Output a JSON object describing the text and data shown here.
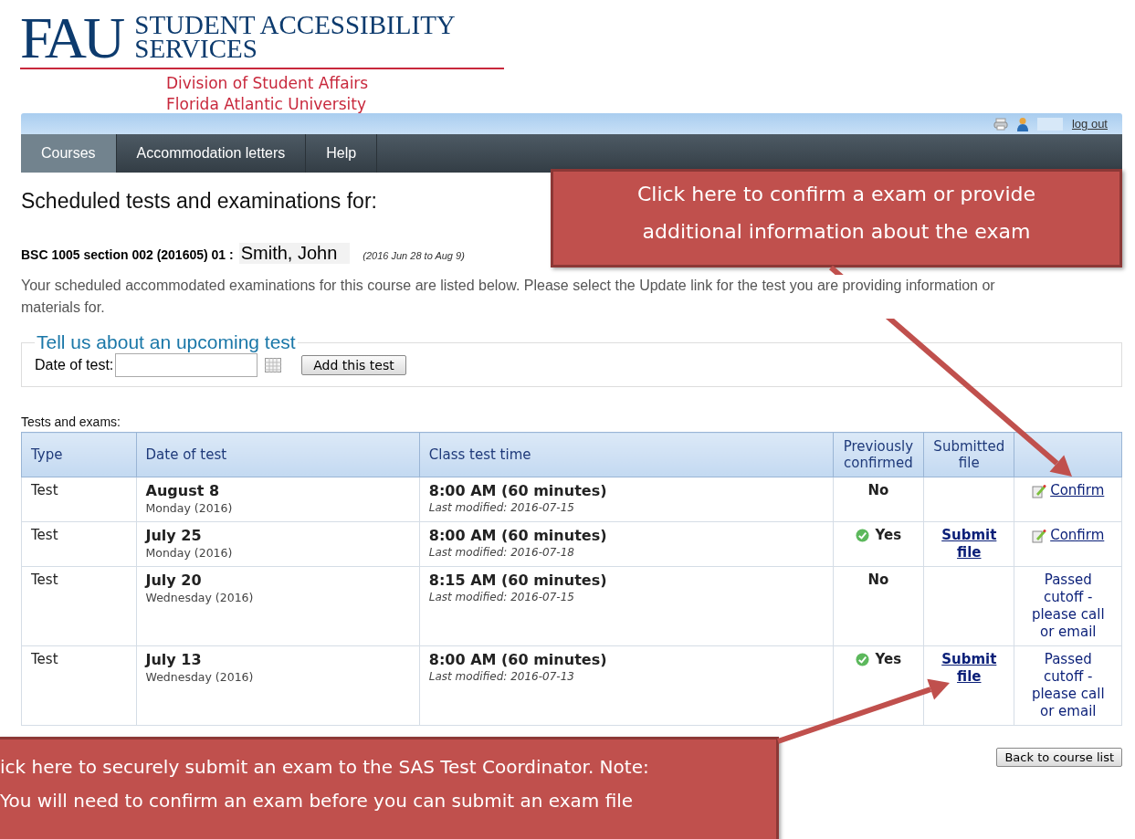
{
  "header": {
    "logo": "FAU",
    "title_lines": [
      "STUDENT ACCESSIBILITY",
      "SERVICES"
    ],
    "subtitle_lines": [
      "Division of Student Affairs",
      "Florida Atlantic University"
    ]
  },
  "toolbar": {
    "logout": "log out"
  },
  "tabs": [
    {
      "label": "Courses",
      "selected": true
    },
    {
      "label": "Accommodation letters",
      "selected": false
    },
    {
      "label": "Help",
      "selected": false
    }
  ],
  "heading": "Scheduled tests and examinations for:",
  "course": {
    "code": "BSC 1005 section 002 (201605) 01 :",
    "student": "Smith, John",
    "dates": "(2016 Jun 28 to Aug 9)"
  },
  "intro": "Your scheduled accommodated examinations for this course are listed below. Please select the Update link for the test you are providing information or materials for.",
  "new_test": {
    "legend": "Tell us about an upcoming test",
    "label": "Date of test:",
    "button": "Add this test"
  },
  "table": {
    "caption": "Tests and exams:",
    "columns": [
      "Type",
      "Date of test",
      "Class test time",
      "Previously confirmed",
      "Submitted file"
    ],
    "rows": [
      {
        "type": "Test",
        "date": "August 8",
        "weekday": "Monday (2016)",
        "time": "8:00 AM (60 minutes)",
        "modified": "Last modified: 2016-07-15",
        "confirmed": false,
        "confirmed_text": "No",
        "file_link": null,
        "action": {
          "kind": "link",
          "text": "Confirm"
        }
      },
      {
        "type": "Test",
        "date": "July 25",
        "weekday": "Monday (2016)",
        "time": "8:00 AM (60 minutes)",
        "modified": "Last modified: 2016-07-18",
        "confirmed": true,
        "confirmed_text": "Yes",
        "file_link": "Submit file",
        "action": {
          "kind": "link",
          "text": "Confirm"
        }
      },
      {
        "type": "Test",
        "date": "July 20",
        "weekday": "Wednesday (2016)",
        "time": "8:15 AM (60 minutes)",
        "modified": "Last modified: 2016-07-15",
        "confirmed": false,
        "confirmed_text": "No",
        "file_link": null,
        "action": {
          "kind": "note",
          "text": "Passed cutoff - please call or email"
        }
      },
      {
        "type": "Test",
        "date": "July 13",
        "weekday": "Wednesday (2016)",
        "time": "8:00 AM (60 minutes)",
        "modified": "Last modified: 2016-07-13",
        "confirmed": true,
        "confirmed_text": "Yes",
        "file_link": "Submit file",
        "action": {
          "kind": "note",
          "text": "Passed cutoff - please call or email"
        }
      }
    ]
  },
  "back_button": "Back to course list",
  "callouts": [
    {
      "lines": [
        "Click here to confirm a exam or provide",
        "additional information about the exam"
      ]
    },
    {
      "lines": [
        "ick here to securely submit an exam to the SAS Test Coordinator. Note:",
        "You will need to confirm an exam before you can submit an exam file"
      ]
    }
  ]
}
